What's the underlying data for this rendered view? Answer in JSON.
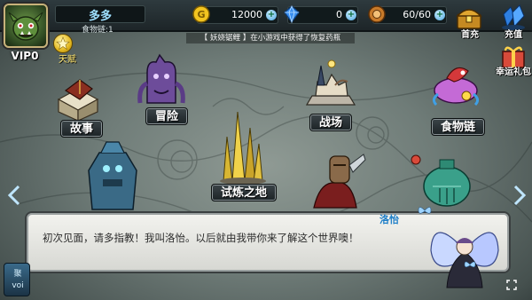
{
  "player": {
    "name": "多多",
    "food_link": "食物链:1",
    "vip": "VIP0",
    "talent_label": "天赋"
  },
  "resources": [
    {
      "icon": "gold-coin-icon",
      "value": "12000"
    },
    {
      "icon": "blue-gem-icon",
      "value": "0"
    },
    {
      "icon": "stamina-icon",
      "value": "60/60"
    }
  ],
  "notice": "【 妖娆锯鲤 】在小游戏中获得了恢复药瓶",
  "side_buttons": {
    "first_charge": "首充",
    "recharge": "充值",
    "lucky_pack": "幸运礼包"
  },
  "buildings": [
    {
      "label": "故事"
    },
    {
      "label": "冒险"
    },
    {
      "label": "战场"
    },
    {
      "label": "食物链"
    },
    {
      "label": "试炼之地"
    }
  ],
  "dialog": {
    "speaker": "洛怡",
    "text": "初次见面，请多指教！我叫洛怡。以后就由我带你来了解这个世界噢！"
  },
  "chat_tab": {
    "line1": "聚",
    "line2": "voi"
  },
  "colors": {
    "accent_blue": "#1f7fc8",
    "name_blue": "#9ee0ff",
    "gold": "#e3b820",
    "topbar": "#2e3a3e"
  }
}
